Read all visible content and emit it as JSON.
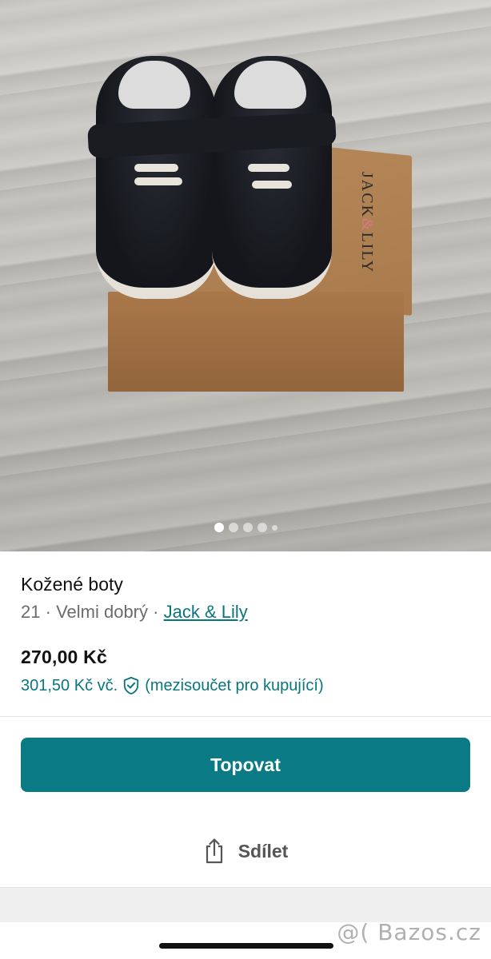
{
  "photo": {
    "brand_print": [
      "JACK",
      "&",
      "LILY"
    ],
    "carousel": {
      "total_dots": 5,
      "active_index": 0
    }
  },
  "listing": {
    "title": "Kožené boty",
    "size": "21",
    "separator": "·",
    "condition": "Velmi dobrý",
    "brand": "Jack & Lily",
    "price": "270,00 Kč",
    "total_price": "301,50 Kč vč.",
    "total_note": "(mezisoučet pro kupující)"
  },
  "actions": {
    "promote_label": "Topovat",
    "share_label": "Sdílet"
  },
  "watermark": "@( Bazos.cz",
  "colors": {
    "accent": "#0a7a84",
    "link": "#09767f",
    "muted_text": "#6b6b6b"
  },
  "icons": [
    "shield-check-icon",
    "share-icon"
  ]
}
